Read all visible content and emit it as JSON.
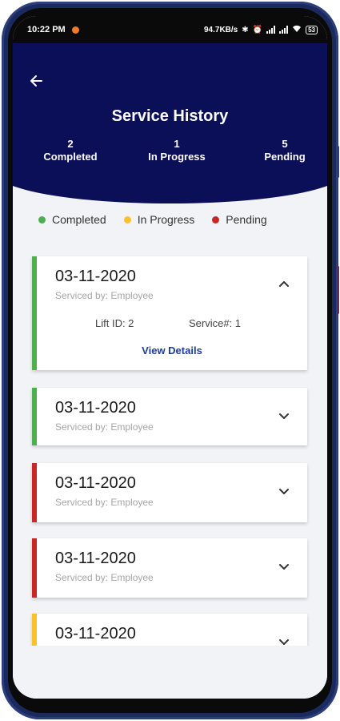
{
  "status_bar": {
    "time": "10:22 PM",
    "network_speed": "94.7KB/s",
    "battery": "53",
    "icons": [
      "bluetooth-icon",
      "alarm-icon",
      "volte-icon",
      "signal-icon",
      "wifi-icon",
      "battery-icon"
    ]
  },
  "header": {
    "title": "Service History",
    "stats": [
      {
        "count": "2",
        "label": "Completed"
      },
      {
        "count": "1",
        "label": "In Progress"
      },
      {
        "count": "5",
        "label": "Pending"
      }
    ]
  },
  "legend": [
    {
      "label": "Completed",
      "color": "#4caf50"
    },
    {
      "label": "In Progress",
      "color": "#fbc02d"
    },
    {
      "label": "Pending",
      "color": "#c62828"
    }
  ],
  "cards": [
    {
      "date": "03-11-2020",
      "serviced_by": "Serviced by: Employee",
      "status": "completed",
      "color": "#4caf50",
      "expanded": true,
      "lift_id": "Lift ID: 2",
      "service_no": "Service#: 1",
      "link": "View Details"
    },
    {
      "date": "03-11-2020",
      "serviced_by": "Serviced by: Employee",
      "status": "completed",
      "color": "#4caf50",
      "expanded": false
    },
    {
      "date": "03-11-2020",
      "serviced_by": "Serviced by: Employee",
      "status": "pending",
      "color": "#c62828",
      "expanded": false
    },
    {
      "date": "03-11-2020",
      "serviced_by": "Serviced by: Employee",
      "status": "pending",
      "color": "#c62828",
      "expanded": false
    },
    {
      "date": "03-11-2020",
      "serviced_by": "",
      "status": "in-progress",
      "color": "#fbc02d",
      "expanded": false
    }
  ]
}
